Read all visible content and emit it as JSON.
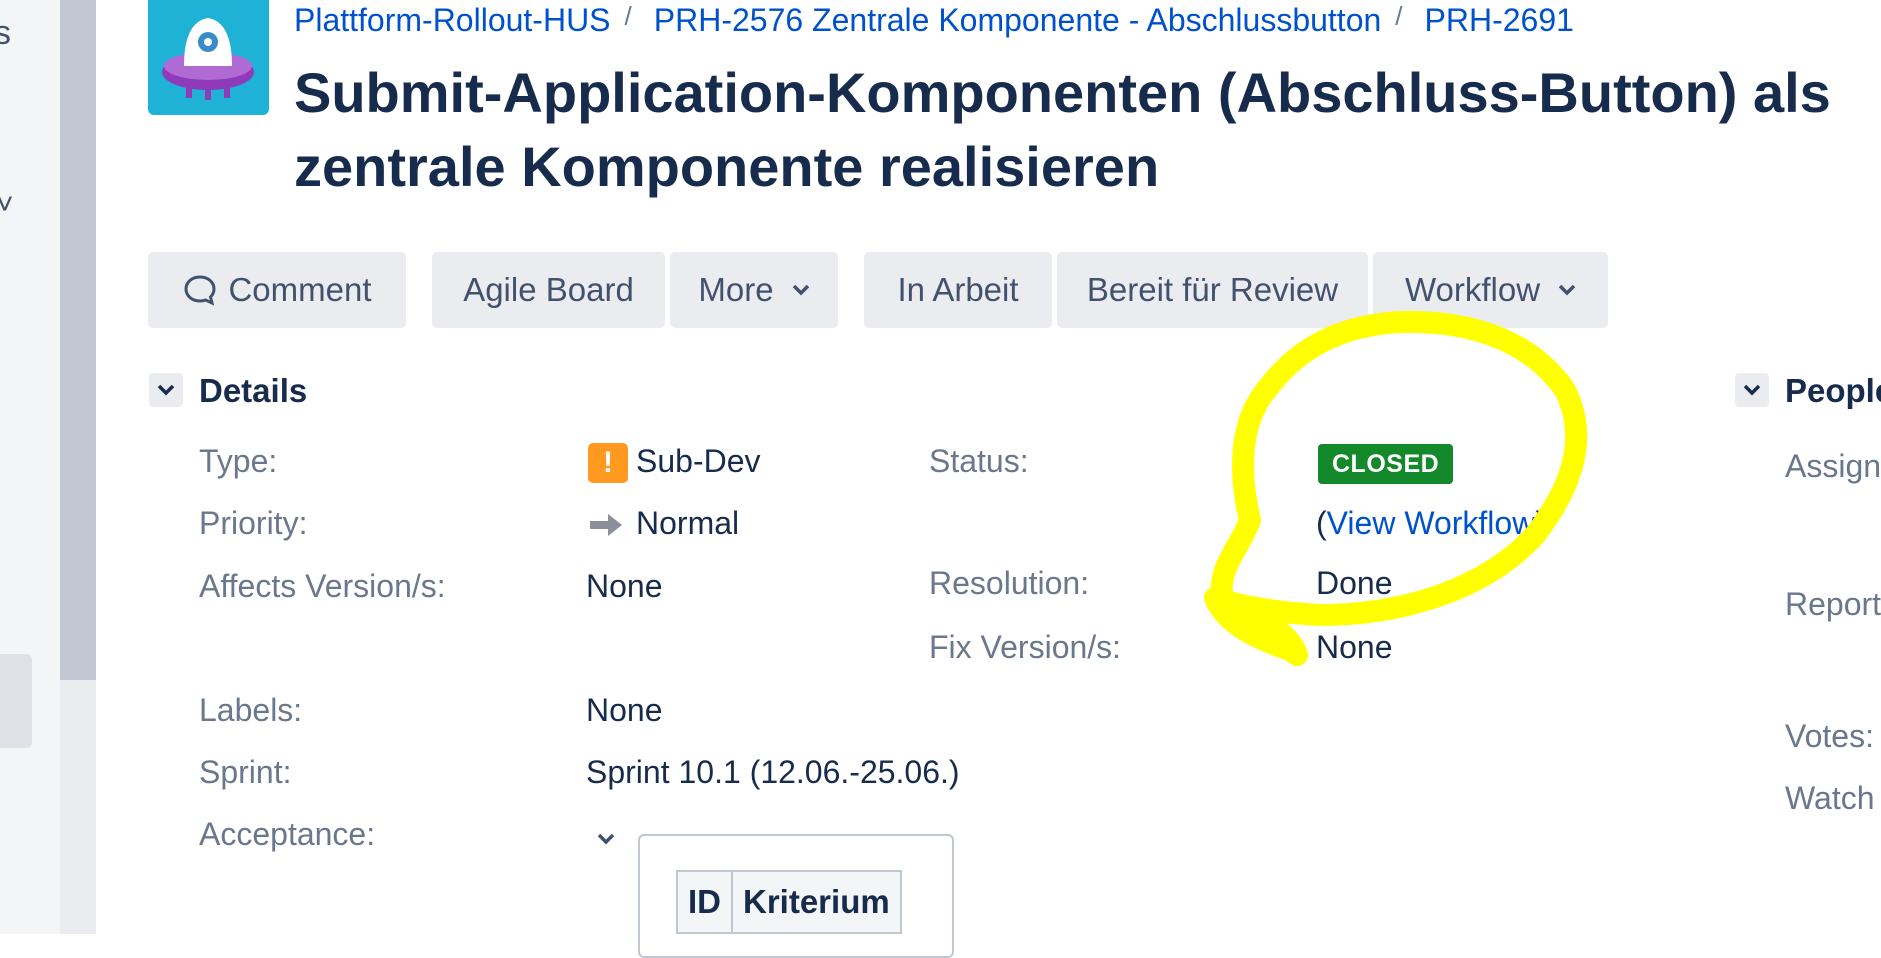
{
  "breadcrumb": {
    "project": "Plattform-Rollout-HUS",
    "parent": "PRH-2576 Zentrale Komponente - Abschlussbutton",
    "issue_key": "PRH-2691",
    "separator": "/"
  },
  "issue": {
    "title": "Submit-Application-Komponenten (Abschluss-Button) als zentrale Komponente realisieren"
  },
  "toolbar": {
    "comment": "Comment",
    "agile_board": "Agile Board",
    "more": "More",
    "in_arbeit": "In Arbeit",
    "bereit_review": "Bereit für Review",
    "workflow": "Workflow"
  },
  "details": {
    "section_title": "Details",
    "type_label": "Type:",
    "type_value": "Sub-Dev",
    "type_icon_glyph": "!",
    "priority_label": "Priority:",
    "priority_value": "Normal",
    "affects_label": "Affects Version/s:",
    "affects_value": "None",
    "labels_label": "Labels:",
    "labels_value": "None",
    "sprint_label": "Sprint:",
    "sprint_value": "Sprint 10.1 (12.06.-25.06.)",
    "acceptance_label": "Acceptance:",
    "status_label": "Status:",
    "status_value": "CLOSED",
    "view_workflow_open": "(",
    "view_workflow": "View Workflow",
    "view_workflow_close": ")",
    "resolution_label": "Resolution:",
    "resolution_value": "Done",
    "fix_label": "Fix Version/s:",
    "fix_value": "None"
  },
  "acceptance_table": {
    "headers": [
      "ID",
      "Kriterium"
    ]
  },
  "people": {
    "section_title": "People",
    "assignee_label": "Assign",
    "reporter_label": "Report",
    "votes_label": "Votes:",
    "watchers_label": "Watch"
  },
  "left_nav": {
    "glyph_top": "s",
    "glyph_mid": "˅"
  },
  "colors": {
    "status_closed": "#14892c",
    "link": "#0052cc",
    "highlight": "#ffff00",
    "type_icon": "#ff991f"
  }
}
